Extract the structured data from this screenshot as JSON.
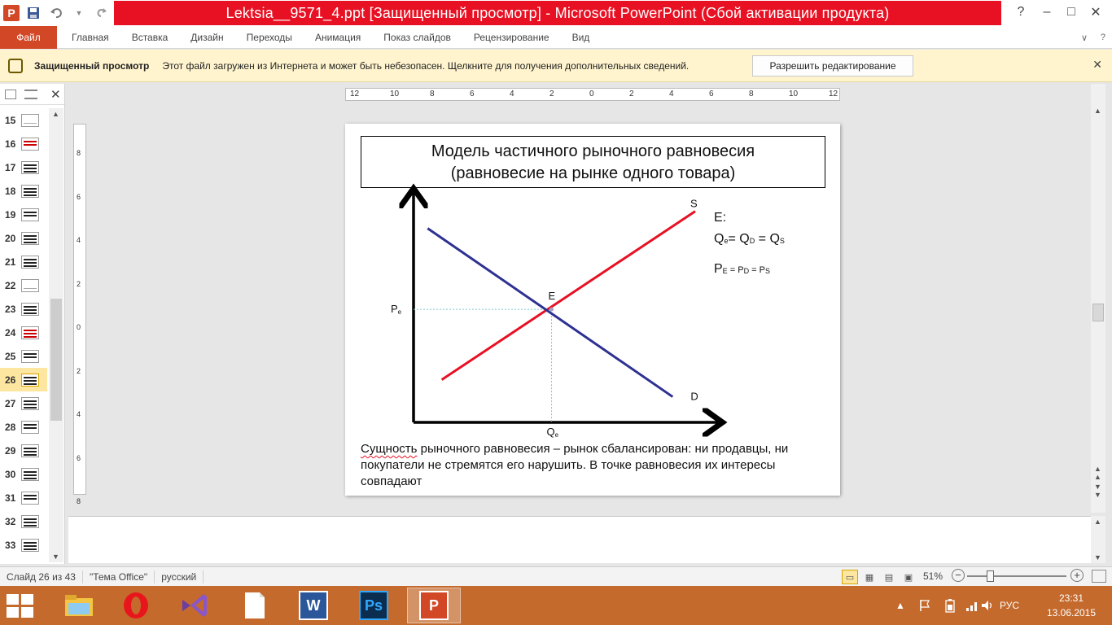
{
  "window": {
    "title": "Lektsia__9571_4.ppt [Защищенный просмотр] - Microsoft PowerPoint (Сбой активации продукта)",
    "app_icon_letter": "P",
    "help": "?",
    "minimize": "–",
    "maximize": "□",
    "close": "✕"
  },
  "ribbon": {
    "file": "Файл",
    "tabs": [
      "Главная",
      "Вставка",
      "Дизайн",
      "Переходы",
      "Анимация",
      "Показ слайдов",
      "Рецензирование",
      "Вид"
    ],
    "collapse_glyph": "∨",
    "help_glyph": "?"
  },
  "protected_view": {
    "title": "Защищенный просмотр",
    "message": "Этот файл загружен из Интернета и может быть небезопасен. Щелкните для получения дополнительных сведений.",
    "button": "Разрешить редактирование",
    "close": "✕"
  },
  "thumbnails": {
    "close": "✕",
    "items": [
      "15",
      "16",
      "17",
      "18",
      "19",
      "20",
      "21",
      "22",
      "23",
      "24",
      "25",
      "26",
      "27",
      "28",
      "29",
      "30",
      "31",
      "32",
      "33"
    ],
    "active": "26"
  },
  "ruler": {
    "h_labels": [
      "12",
      "10",
      "8",
      "6",
      "4",
      "2",
      "0",
      "2",
      "4",
      "6",
      "8",
      "10",
      "12"
    ],
    "v_labels": [
      "8",
      "6",
      "4",
      "2",
      "0",
      "2",
      "4",
      "6",
      "8"
    ]
  },
  "slide": {
    "title_line1": "Модель частичного рыночного равновесия",
    "title_line2": "(равновесие на рынке одного товара)",
    "legend": {
      "line1": "E:",
      "q_e": "Q",
      "q_e_sub": "e",
      "q_eq": "= Q",
      "q_d_sub": "D",
      "q_eq2": " = Q",
      "q_s_sub": "S",
      "p_e": "P",
      "p_e_sub": "E",
      "p_eq": " = P",
      "p_d_sub": "D",
      "p_eq2": " = P",
      "p_s_sub": "S"
    },
    "body_text_squiggle": "Сущность",
    "body_text_rest": " рыночного равновесия – рынок сбалансирован: ни продавцы, ни покупатели не стремятся его нарушить. В точке равновесия их интересы совпадают"
  },
  "chart_data": {
    "type": "line",
    "title": "",
    "xlabel": "",
    "ylabel": "",
    "point_label": "E",
    "p_label": "P",
    "p_sub": "e",
    "q_label": "Q",
    "q_sub": "e",
    "series": [
      {
        "name": "S",
        "color": "#e81123",
        "x": [
          0.1,
          1.0
        ],
        "y": [
          0.2,
          0.99
        ]
      },
      {
        "name": "D",
        "color": "#2e3192",
        "x": [
          0.05,
          0.92
        ],
        "y": [
          0.91,
          0.12
        ]
      }
    ],
    "equilibrium": {
      "x": 0.49,
      "y": 0.53
    },
    "xlim": [
      0,
      1
    ],
    "ylim": [
      0,
      1
    ],
    "grid": false
  },
  "statusbar": {
    "slide_info": "Слайд 26 из 43",
    "theme": "\"Тема Office\"",
    "language": "русский",
    "zoom": "51%",
    "zoom_minus": "−",
    "zoom_plus": "+",
    "zoom_level": 0.23
  },
  "taskbar": {
    "tray_lang": "РУС",
    "time": "23:31",
    "date": "13.06.2015",
    "apps": [
      "file-explorer",
      "opera",
      "visual-studio",
      "blank-document",
      "word",
      "photoshop",
      "powerpoint"
    ],
    "photoshop_label": "Ps",
    "word_label": "W"
  },
  "colors": {
    "title_bar_red": "#e81123",
    "file_tab": "#d24726",
    "protected_bar": "#fff4ce",
    "taskbar": "#c46a2d",
    "supply_line": "#e81123",
    "demand_line": "#2e3192"
  }
}
